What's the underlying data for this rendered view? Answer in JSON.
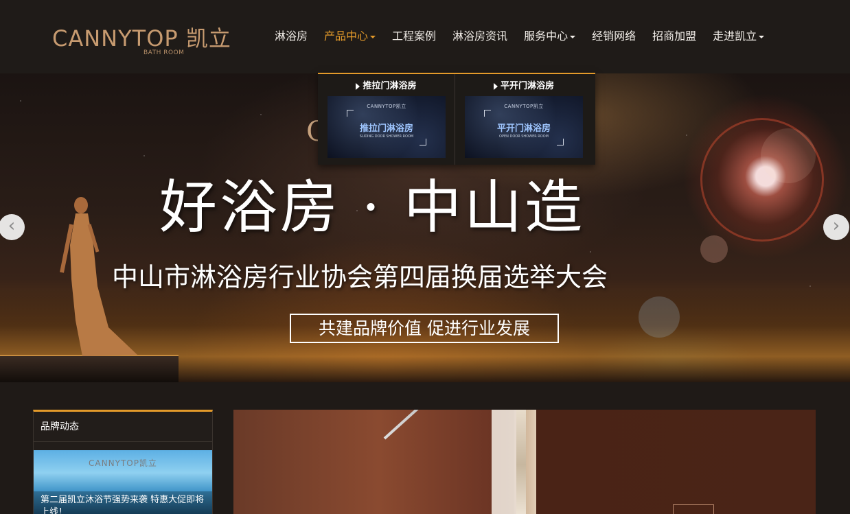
{
  "brand": {
    "logo_text": "CANNYTOP 凯立",
    "logo_sub": "BATH ROOM"
  },
  "nav": {
    "items": [
      {
        "label": "淋浴房"
      },
      {
        "label": "产品中心",
        "active": true,
        "has_caret": true
      },
      {
        "label": "工程案例"
      },
      {
        "label": "淋浴房资讯"
      },
      {
        "label": "服务中心",
        "has_caret": true
      },
      {
        "label": "经销网络"
      },
      {
        "label": "招商加盟"
      },
      {
        "label": "走进凯立",
        "has_caret": true
      }
    ]
  },
  "dropdown": {
    "columns": [
      {
        "title": "推拉门淋浴房",
        "thumb_logo": "CANNYTOP凯立",
        "thumb_title": "推拉门淋浴房",
        "thumb_sub": "SLIDING DOOR SHOWER ROOM"
      },
      {
        "title": "平开门淋浴房",
        "thumb_logo": "CANNYTOP凯立",
        "thumb_title": "平开门淋浴房",
        "thumb_sub": "OPEN DOOR SHOWER ROOM"
      }
    ]
  },
  "banner": {
    "partial_text": "C",
    "headline": "好浴房 · 中山造",
    "subline": "中山市淋浴房行业协会第四届换届选举大会",
    "slogan": "共建品牌价值 促进行业发展",
    "prev_icon": "chevron-left-icon",
    "next_icon": "chevron-right-icon"
  },
  "brand_news": {
    "title": "品牌动态",
    "image_logo": "CANNYTOP凯立",
    "caption": "第二届凯立沐浴节强势来袭 特惠大促即将上线！"
  },
  "colors": {
    "accent": "#e39a2a",
    "header_bg": "#1f1b18",
    "logo": "#c79b70"
  }
}
